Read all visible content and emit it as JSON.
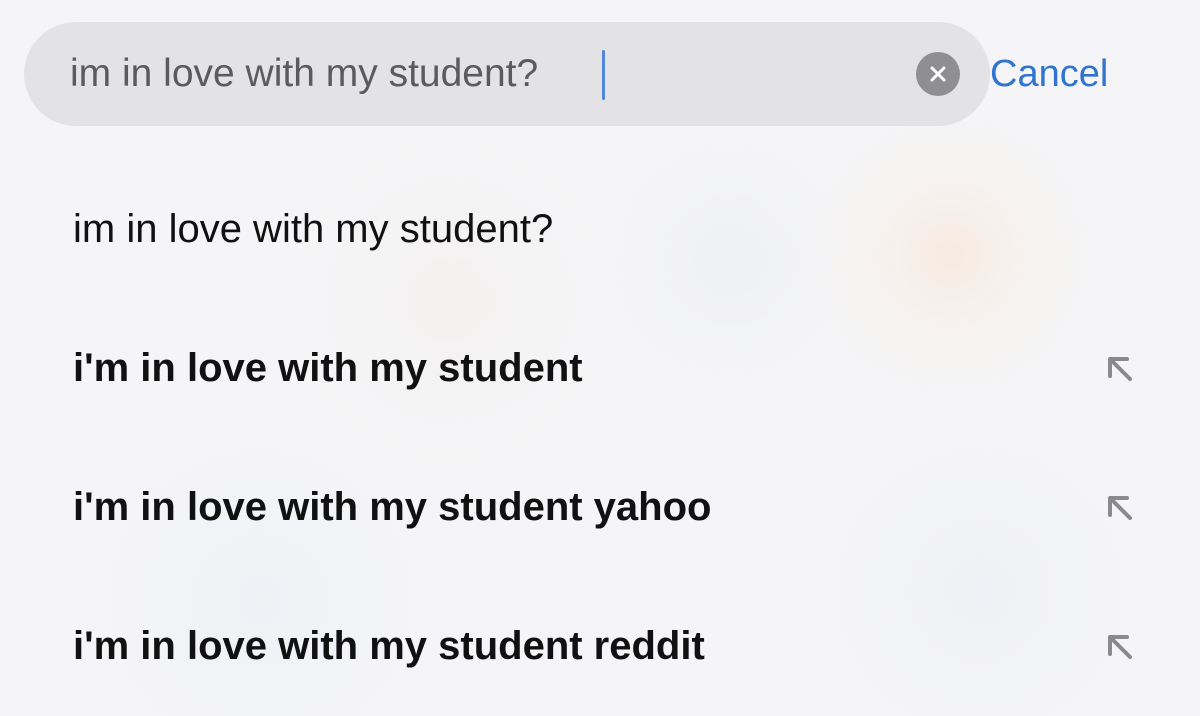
{
  "search": {
    "value": "im in love with my student?",
    "cancel_label": "Cancel"
  },
  "suggestions": [
    {
      "text": "im in love with my student?",
      "bold": false,
      "has_fill_arrow": false
    },
    {
      "text": "i'm in love with my student",
      "bold": true,
      "has_fill_arrow": true
    },
    {
      "text": "i'm in love with my student yahoo",
      "bold": true,
      "has_fill_arrow": true
    },
    {
      "text": "i'm in love with my student reddit",
      "bold": true,
      "has_fill_arrow": true
    }
  ],
  "icons": {
    "clear": "clear-icon",
    "fill_arrow": "arrow-up-left-icon"
  },
  "colors": {
    "accent": "#2f74d0",
    "caret": "#4f87dc",
    "search_field": "#e3e3e6",
    "clear_button": "#8e8e93",
    "arrow": "#8a8a8e"
  }
}
